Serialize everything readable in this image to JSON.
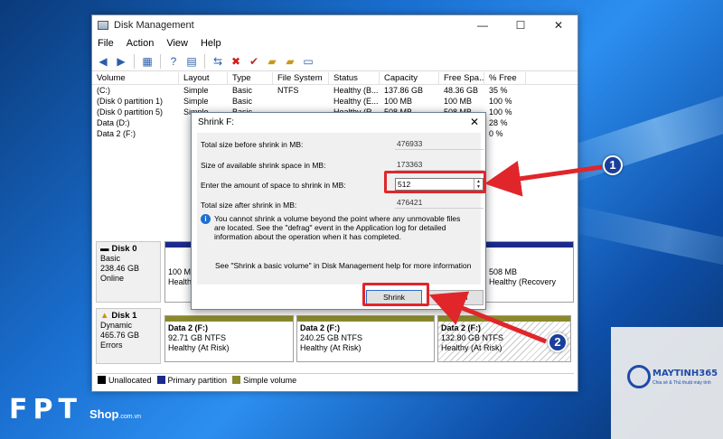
{
  "window": {
    "title": "Disk Management",
    "menu": [
      "File",
      "Action",
      "View",
      "Help"
    ],
    "controls": {
      "minimize": "—",
      "maximize": "☐",
      "close": "✕"
    }
  },
  "volume_table": {
    "headers": [
      "Volume",
      "Layout",
      "Type",
      "File System",
      "Status",
      "Capacity",
      "Free Spa...",
      "% Free"
    ],
    "rows": [
      [
        "(C:)",
        "Simple",
        "Basic",
        "NTFS",
        "Healthy (B...",
        "137.86 GB",
        "48.36 GB",
        "35 %"
      ],
      [
        "(Disk 0 partition 1)",
        "Simple",
        "Basic",
        "",
        "Healthy (E...",
        "100 MB",
        "100 MB",
        "100 %"
      ],
      [
        "(Disk 0 partition 5)",
        "Simple",
        "Basic",
        "",
        "Healthy (R...",
        "508 MB",
        "508 MB",
        "100 %"
      ],
      [
        "Data (D:)",
        "",
        "",
        "",
        "",
        "",
        "",
        "28 %"
      ],
      [
        "Data 2 (F:)",
        "",
        "",
        "",
        "",
        "",
        "",
        "0 %"
      ]
    ]
  },
  "disks": [
    {
      "name": "Disk 0",
      "type": "Basic",
      "size": "238.46 GB",
      "state": "Online"
    },
    {
      "name": "Disk 1",
      "type": "Dynamic",
      "size": "465.76 GB",
      "state": "Errors"
    }
  ],
  "disk0_parts": [
    {
      "size": "100 MB",
      "status": "Healthy"
    },
    {
      "size": "508 MB",
      "status": "Healthy (Recovery"
    }
  ],
  "disk1_parts": [
    {
      "name": "Data 2  (F:)",
      "size": "92.71 GB NTFS",
      "status": "Healthy (At Risk)"
    },
    {
      "name": "Data 2  (F:)",
      "size": "240.25 GB NTFS",
      "status": "Healthy (At Risk)"
    },
    {
      "name": "Data 2  (F:)",
      "size": "132.80 GB NTFS",
      "status": "Healthy (At Risk)"
    }
  ],
  "legend": [
    "Unallocated",
    "Primary partition",
    "Simple volume"
  ],
  "dialog": {
    "title": "Shrink F:",
    "total_before_label": "Total size before shrink in MB:",
    "total_before": "476933",
    "available_label": "Size of available shrink space in MB:",
    "available": "173363",
    "amount_label": "Enter the amount of space to shrink in MB:",
    "amount": "512",
    "after_label": "Total size after shrink in MB:",
    "after": "476421",
    "info": "You cannot shrink a volume beyond the point where any unmovable files are located. See the \"defrag\" event in the Application log for detailed information about the operation when it has completed.",
    "help": "See \"Shrink a basic volume\" in Disk Management help for more information",
    "shrink": "Shrink",
    "cancel": "Cancel"
  },
  "callouts": [
    "1",
    "2"
  ],
  "brand": {
    "card_name": "MAYTINH365",
    "card_sub": "Chia sẻ & Thủ thuật máy tính",
    "fpt": "FPT",
    "shop": "Shop",
    "domain": ".com.vn"
  },
  "colors": {
    "primary_partition": "#1b2a8c",
    "simple_volume": "#8a8a2a",
    "callout_red": "#e0262a",
    "callout_badge": "#1a3f9a"
  }
}
